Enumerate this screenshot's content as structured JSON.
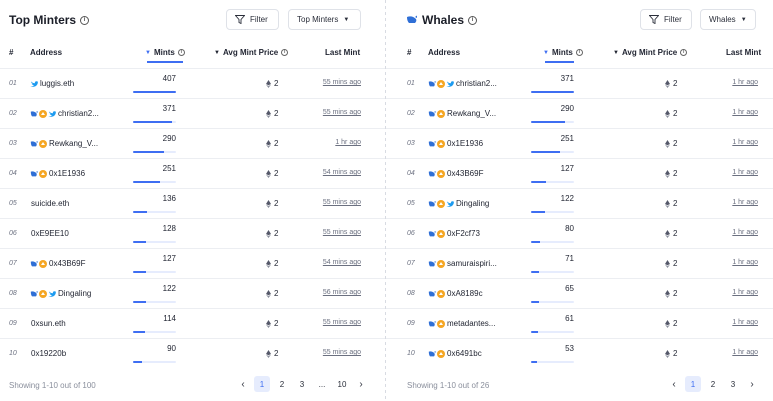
{
  "left": {
    "title": "Top Minters",
    "filter_label": "Filter",
    "dropdown_label": "Top Minters",
    "columns": {
      "rank": "#",
      "address": "Address",
      "mints": "Mints",
      "price": "Avg Mint Price",
      "last": "Last Mint"
    },
    "rows": [
      {
        "rank": "01",
        "address": "luggis.eth",
        "icons": [
          "twitter"
        ],
        "mints": "407",
        "fill": 1.0,
        "price": "2",
        "last": "55 mins ago"
      },
      {
        "rank": "02",
        "address": "christian2...",
        "icons": [
          "whale",
          "opensea",
          "twitter"
        ],
        "mints": "371",
        "fill": 0.91,
        "price": "2",
        "last": "55 mins ago"
      },
      {
        "rank": "03",
        "address": "Rewkang_V...",
        "icons": [
          "whale",
          "opensea"
        ],
        "mints": "290",
        "fill": 0.71,
        "price": "2",
        "last": "1 hr ago"
      },
      {
        "rank": "04",
        "address": "0x1E1936",
        "icons": [
          "whale",
          "opensea"
        ],
        "mints": "251",
        "fill": 0.62,
        "price": "2",
        "last": "54 mins ago"
      },
      {
        "rank": "05",
        "address": "suicide.eth",
        "icons": [],
        "mints": "136",
        "fill": 0.33,
        "price": "2",
        "last": "55 mins ago"
      },
      {
        "rank": "06",
        "address": "0xE9EE10",
        "icons": [],
        "mints": "128",
        "fill": 0.31,
        "price": "2",
        "last": "55 mins ago"
      },
      {
        "rank": "07",
        "address": "0x43B69F",
        "icons": [
          "whale",
          "opensea"
        ],
        "mints": "127",
        "fill": 0.31,
        "price": "2",
        "last": "54 mins ago"
      },
      {
        "rank": "08",
        "address": "Dingaling",
        "icons": [
          "whale",
          "opensea",
          "twitter"
        ],
        "mints": "122",
        "fill": 0.3,
        "price": "2",
        "last": "56 mins ago"
      },
      {
        "rank": "09",
        "address": "0xsun.eth",
        "icons": [],
        "mints": "114",
        "fill": 0.28,
        "price": "2",
        "last": "55 mins ago"
      },
      {
        "rank": "10",
        "address": "0x19220b",
        "icons": [],
        "mints": "90",
        "fill": 0.22,
        "price": "2",
        "last": "55 mins ago"
      }
    ],
    "showing": "Showing 1-10 out of 100",
    "pages": [
      "1",
      "2",
      "3",
      "...",
      "10"
    ]
  },
  "right": {
    "title": "Whales",
    "filter_label": "Filter",
    "dropdown_label": "Whales",
    "columns": {
      "rank": "#",
      "address": "Address",
      "mints": "Mints",
      "price": "Avg Mint Price",
      "last": "Last Mint"
    },
    "rows": [
      {
        "rank": "01",
        "address": "christian2...",
        "icons": [
          "whale",
          "opensea",
          "twitter"
        ],
        "mints": "371",
        "fill": 1.0,
        "price": "2",
        "last": "1 hr ago"
      },
      {
        "rank": "02",
        "address": "Rewkang_V...",
        "icons": [
          "whale",
          "opensea"
        ],
        "mints": "290",
        "fill": 0.78,
        "price": "2",
        "last": "1 hr ago"
      },
      {
        "rank": "03",
        "address": "0x1E1936",
        "icons": [
          "whale",
          "opensea"
        ],
        "mints": "251",
        "fill": 0.68,
        "price": "2",
        "last": "1 hr ago"
      },
      {
        "rank": "04",
        "address": "0x43B69F",
        "icons": [
          "whale",
          "opensea"
        ],
        "mints": "127",
        "fill": 0.34,
        "price": "2",
        "last": "1 hr ago"
      },
      {
        "rank": "05",
        "address": "Dingaling",
        "icons": [
          "whale",
          "opensea",
          "twitter"
        ],
        "mints": "122",
        "fill": 0.33,
        "price": "2",
        "last": "1 hr ago"
      },
      {
        "rank": "06",
        "address": "0xF2cf73",
        "icons": [
          "whale",
          "opensea"
        ],
        "mints": "80",
        "fill": 0.22,
        "price": "2",
        "last": "1 hr ago"
      },
      {
        "rank": "07",
        "address": "samuraispiri...",
        "icons": [
          "whale",
          "opensea"
        ],
        "mints": "71",
        "fill": 0.19,
        "price": "2",
        "last": "1 hr ago"
      },
      {
        "rank": "08",
        "address": "0xA8189c",
        "icons": [
          "whale",
          "opensea"
        ],
        "mints": "65",
        "fill": 0.18,
        "price": "2",
        "last": "1 hr ago"
      },
      {
        "rank": "09",
        "address": "metadantes...",
        "icons": [
          "whale",
          "opensea"
        ],
        "mints": "61",
        "fill": 0.16,
        "price": "2",
        "last": "1 hr ago"
      },
      {
        "rank": "10",
        "address": "0x6491bc",
        "icons": [
          "whale",
          "opensea"
        ],
        "mints": "53",
        "fill": 0.14,
        "price": "2",
        "last": "1 hr ago"
      }
    ],
    "showing": "Showing 1-10 out of 26",
    "pages": [
      "1",
      "2",
      "3"
    ]
  },
  "colors": {
    "accent": "#3e6ef2",
    "bar_track": "#e6ecfd",
    "opensea": "#f5a623",
    "twitter": "#1d9bf0",
    "whale": "#2f6fd6"
  }
}
